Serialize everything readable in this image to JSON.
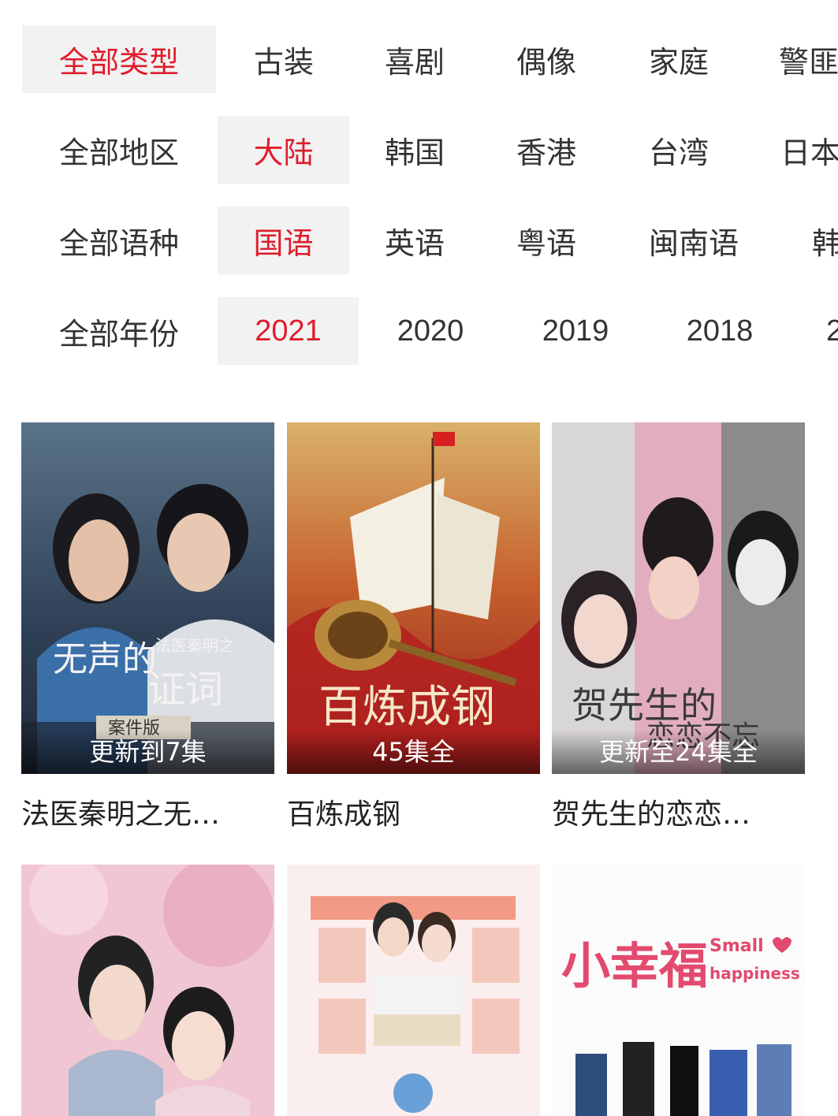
{
  "filters": {
    "type": {
      "options": [
        "全部类型",
        "古装",
        "喜剧",
        "偶像",
        "家庭",
        "警匪"
      ],
      "selected": 0
    },
    "region": {
      "options": [
        "全部地区",
        "大陆",
        "韩国",
        "香港",
        "台湾",
        "日本"
      ],
      "selected": 1
    },
    "language": {
      "options": [
        "全部语种",
        "国语",
        "英语",
        "粤语",
        "闽南语",
        "韩"
      ],
      "selected": 1
    },
    "year": {
      "options": [
        "全部年份",
        "2021",
        "2020",
        "2019",
        "2018",
        "2"
      ],
      "selected": 1
    }
  },
  "cards": [
    {
      "title": "法医秦明之无…",
      "badge": "更新到7集",
      "poster_text": "法医秦明之 无声的证词"
    },
    {
      "title": "百炼成钢",
      "badge": "45集全",
      "poster_text": "百炼成钢"
    },
    {
      "title": "贺先生的恋恋…",
      "badge": "更新至24集全",
      "poster_text": "贺先生的恋恋不忘"
    },
    {
      "title": "",
      "badge": "",
      "poster_text": ""
    },
    {
      "title": "",
      "badge": "",
      "poster_text": ""
    },
    {
      "title": "",
      "badge": "",
      "poster_text": "小幸福 Small happiness"
    }
  ],
  "colors": {
    "accent": "#e01c2c",
    "chip_bg": "#f2f2f2",
    "text": "#333333"
  }
}
